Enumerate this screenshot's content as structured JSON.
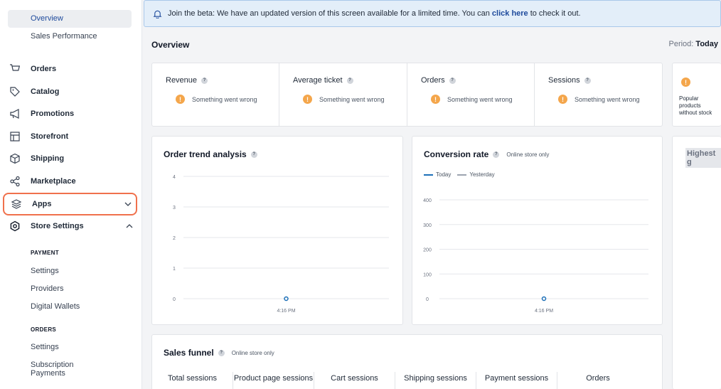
{
  "sidebar": {
    "dashboard_subitems": [
      {
        "label": "Overview"
      },
      {
        "label": "Sales Performance"
      }
    ],
    "nav": [
      {
        "label": "Orders",
        "icon": "cart-icon"
      },
      {
        "label": "Catalog",
        "icon": "tag-icon"
      },
      {
        "label": "Promotions",
        "icon": "megaphone-icon"
      },
      {
        "label": "Storefront",
        "icon": "layout-icon"
      },
      {
        "label": "Shipping",
        "icon": "box-icon"
      },
      {
        "label": "Marketplace",
        "icon": "share-icon"
      },
      {
        "label": "Apps",
        "icon": "layers-icon"
      },
      {
        "label": "Store Settings",
        "icon": "gear-icon"
      }
    ],
    "payment": {
      "title": "PAYMENT",
      "items": [
        {
          "label": "Settings"
        },
        {
          "label": "Providers"
        },
        {
          "label": "Digital Wallets"
        }
      ]
    },
    "orders": {
      "title": "ORDERS",
      "items": [
        {
          "label": "Settings"
        },
        {
          "label": "Subscription Payments"
        }
      ]
    }
  },
  "banner": {
    "text_before": "Join the beta: We have an updated version of this screen available for a limited time. You can",
    "link": "click here",
    "text_after": "to check it out."
  },
  "overview": {
    "title": "Overview",
    "period_label": "Period:",
    "period_value": "Today"
  },
  "kpis": [
    {
      "name": "Revenue",
      "error": "Something went wrong"
    },
    {
      "name": "Average ticket",
      "error": "Something went wrong"
    },
    {
      "name": "Orders",
      "error": "Something went wrong"
    },
    {
      "name": "Sessions",
      "error": "Something went wrong"
    }
  ],
  "side_card": {
    "text": "Popular products without stock"
  },
  "highest_card": {
    "text": "Highest g"
  },
  "order_trend": {
    "title": "Order trend analysis",
    "chart_data": {
      "type": "line",
      "title": "Order trend analysis",
      "x": [
        "4:16 PM"
      ],
      "series": [
        {
          "values": [
            0
          ]
        }
      ],
      "yticks": [
        0,
        1,
        2,
        3,
        4
      ],
      "ylim": [
        0,
        4
      ],
      "grid": true
    }
  },
  "conversion": {
    "title": "Conversion rate",
    "note": "Online store only",
    "legend": [
      {
        "name": "Today",
        "color": "#1d70b8"
      },
      {
        "name": "Yesterday",
        "color": "#9ca3af"
      }
    ],
    "chart_data": {
      "type": "line",
      "title": "Conversion rate",
      "x": [
        "4:16 PM"
      ],
      "series": [
        {
          "name": "Today",
          "values": [
            0
          ]
        },
        {
          "name": "Yesterday",
          "values": []
        }
      ],
      "yticks": [
        0,
        100,
        200,
        300,
        400
      ],
      "ylim": [
        0,
        400
      ],
      "grid": true
    }
  },
  "funnel": {
    "title": "Sales funnel",
    "note": "Online store only",
    "columns": [
      {
        "label": "Total sessions"
      },
      {
        "label": "Product page sessions"
      },
      {
        "label": "Cart sessions"
      },
      {
        "label": "Shipping sessions"
      },
      {
        "label": "Payment sessions"
      },
      {
        "label": "Orders"
      }
    ]
  }
}
